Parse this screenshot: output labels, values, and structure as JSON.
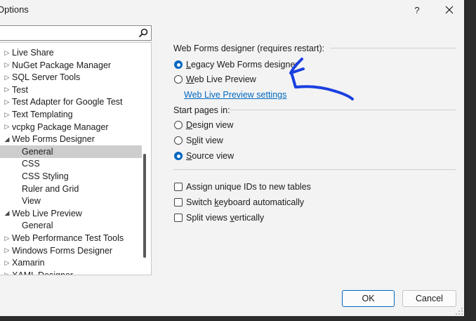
{
  "window": {
    "title": "Options",
    "help_label": "?",
    "close_icon": "close-icon"
  },
  "search": {
    "value": "",
    "icon": "search-icon"
  },
  "tree": {
    "items": [
      {
        "label": "Live Share",
        "arrow": "▷",
        "indent": 0
      },
      {
        "label": "NuGet Package Manager",
        "arrow": "▷",
        "indent": 0
      },
      {
        "label": "SQL Server Tools",
        "arrow": "▷",
        "indent": 0
      },
      {
        "label": "Test",
        "arrow": "▷",
        "indent": 0
      },
      {
        "label": "Test Adapter for Google Test",
        "arrow": "▷",
        "indent": 0
      },
      {
        "label": "Text Templating",
        "arrow": "▷",
        "indent": 0
      },
      {
        "label": "vcpkg Package Manager",
        "arrow": "▷",
        "indent": 0
      },
      {
        "label": "Web Forms Designer",
        "arrow": "◢",
        "indent": 0
      },
      {
        "label": "General",
        "arrow": "",
        "indent": 1,
        "selected": true
      },
      {
        "label": "CSS",
        "arrow": "",
        "indent": 1
      },
      {
        "label": "CSS Styling",
        "arrow": "",
        "indent": 1
      },
      {
        "label": "Ruler and Grid",
        "arrow": "",
        "indent": 1
      },
      {
        "label": "View",
        "arrow": "",
        "indent": 1
      },
      {
        "label": "Web Live Preview",
        "arrow": "◢",
        "indent": 0
      },
      {
        "label": "General",
        "arrow": "",
        "indent": 1
      },
      {
        "label": "Web Performance Test Tools",
        "arrow": "▷",
        "indent": 0
      },
      {
        "label": "Windows Forms Designer",
        "arrow": "▷",
        "indent": 0
      },
      {
        "label": "Xamarin",
        "arrow": "▷",
        "indent": 0
      },
      {
        "label": "XAML Designer",
        "arrow": "▷",
        "indent": 0
      }
    ]
  },
  "designer_section": {
    "header": "Web Forms designer (requires restart):",
    "options": [
      {
        "pre": "",
        "u": "L",
        "post": "egacy Web Forms designer",
        "selected": true
      },
      {
        "pre": "",
        "u": "W",
        "post": "eb Live Preview",
        "selected": false
      }
    ],
    "link": "Web Live Preview settings"
  },
  "start_section": {
    "header": "Start pages in:",
    "options": [
      {
        "pre": "",
        "u": "D",
        "post": "esign view",
        "selected": false
      },
      {
        "pre": "S",
        "u": "p",
        "post": "lit view",
        "selected": false
      },
      {
        "pre": "",
        "u": "S",
        "post": "ource view",
        "selected": true
      }
    ]
  },
  "checkboxes": [
    {
      "pre": "Assi",
      "u": "g",
      "post": "n unique IDs to new tables",
      "checked": false
    },
    {
      "pre": "Switch ",
      "u": "k",
      "post": "eyboard automatically",
      "checked": false
    },
    {
      "pre": "Split views ",
      "u": "v",
      "post": "ertically",
      "checked": false
    }
  ],
  "buttons": {
    "ok": "OK",
    "cancel": "Cancel"
  },
  "colors": {
    "accent": "#0067c0",
    "annotation": "#1a3fe0",
    "background": "#f3f3f3"
  }
}
